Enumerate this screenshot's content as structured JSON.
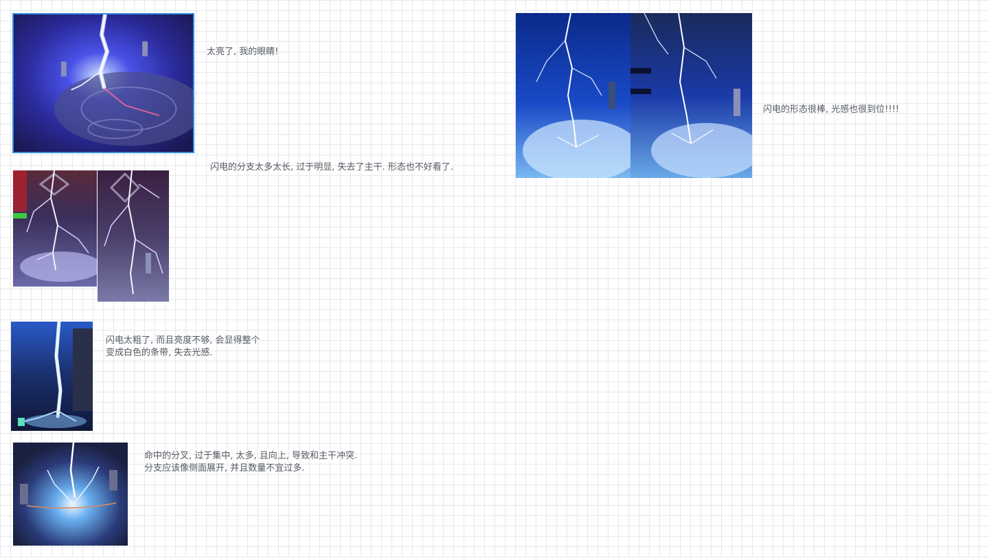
{
  "board": {
    "grid_color": "#e6e8ec",
    "selection_color": "#3a8fe0",
    "text_color": "#555a62"
  },
  "notes": {
    "n1": {
      "lines": [
        "太亮了, 我的眼睛!"
      ]
    },
    "n2": {
      "lines": [
        "闪电的分支太多太长, 过于明显, 失去了主干. 形态也不好看了."
      ]
    },
    "n3": {
      "lines": [
        "闪电太粗了, 而且亮度不够, 会显得整个",
        "变成白色的条带, 失去光感."
      ]
    },
    "n4": {
      "lines": [
        "命中的分叉, 过于集中, 太多, 且向上, 导致和主干冲突.",
        "分支应该像侧面展开, 并且数量不宜过多."
      ]
    },
    "n5": {
      "lines": [
        "闪电的形态很棒, 光感也很到位!!!!"
      ]
    }
  },
  "images": [
    {
      "id": "lightning-shot-too-bright",
      "icon": "lightning-image",
      "selected": true
    },
    {
      "id": "lightning-shot-too-many-branches-a",
      "icon": "lightning-image"
    },
    {
      "id": "lightning-shot-too-many-branches-b",
      "icon": "lightning-image"
    },
    {
      "id": "lightning-shot-too-thick",
      "icon": "lightning-image"
    },
    {
      "id": "lightning-shot-impact-fork",
      "icon": "lightning-image"
    },
    {
      "id": "lightning-shot-good-a",
      "icon": "lightning-image"
    },
    {
      "id": "lightning-shot-good-b",
      "icon": "lightning-image"
    }
  ]
}
